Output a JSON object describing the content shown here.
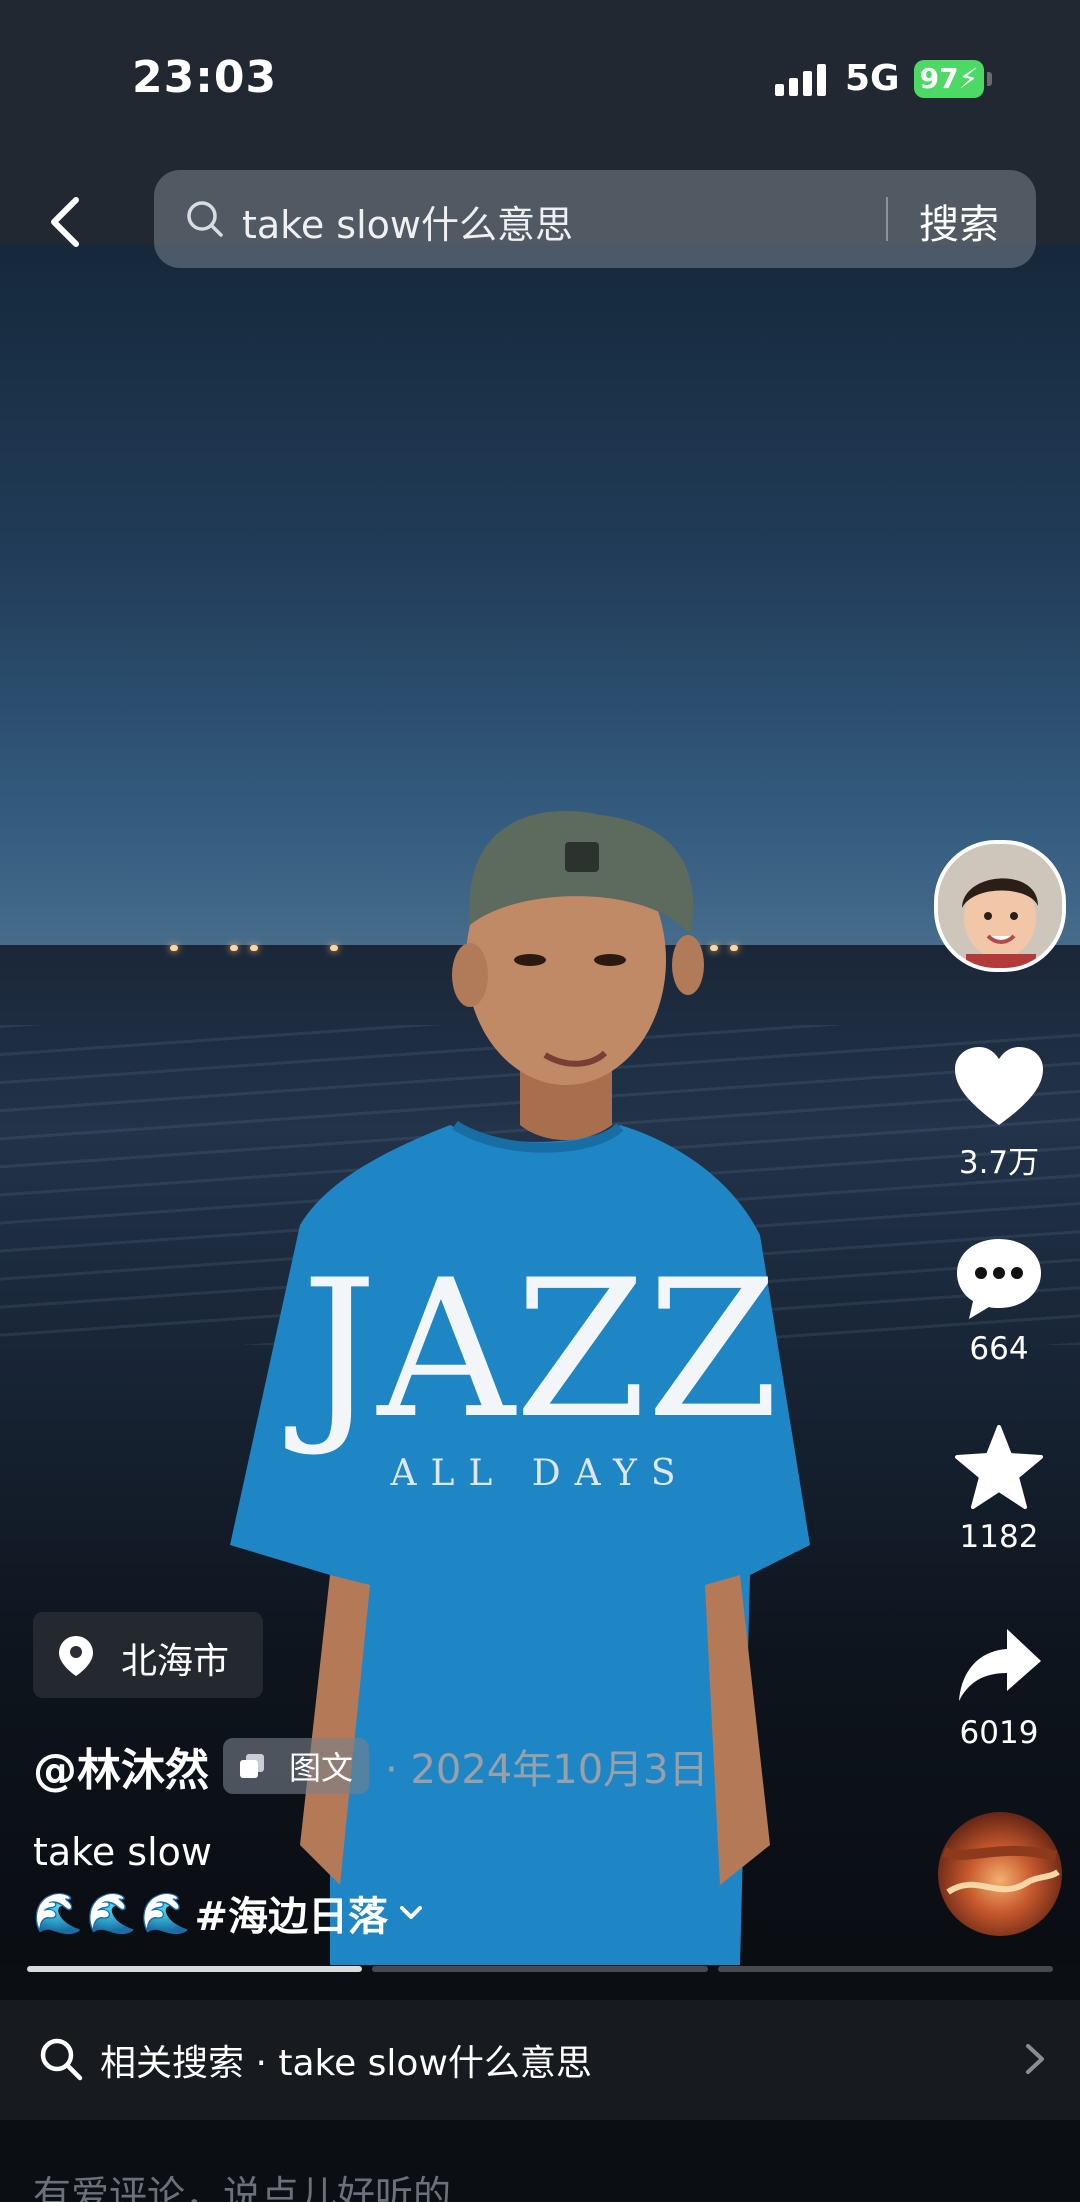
{
  "status_bar": {
    "time": "23:03",
    "network": "5G",
    "battery": "97"
  },
  "search": {
    "query": "take slow什么意思",
    "button_label": "搜索"
  },
  "post": {
    "location": "北海市",
    "author": "@林沐然",
    "type_badge": "图文",
    "date": "· 2024年10月3日",
    "caption": "take slow",
    "hashtag": "#海边日落",
    "shirt_text": "JAZZ",
    "shirt_subtext": "ALL DAYS"
  },
  "actions": {
    "likes": "3.7万",
    "comments": "664",
    "favorites": "1182",
    "shares": "6019"
  },
  "progress": {
    "total_pages": 3,
    "current_page": 1
  },
  "related": {
    "text": "相关搜索 · take slow什么意思"
  },
  "comment": {
    "placeholder": "有爱评论，说点儿好听的"
  }
}
